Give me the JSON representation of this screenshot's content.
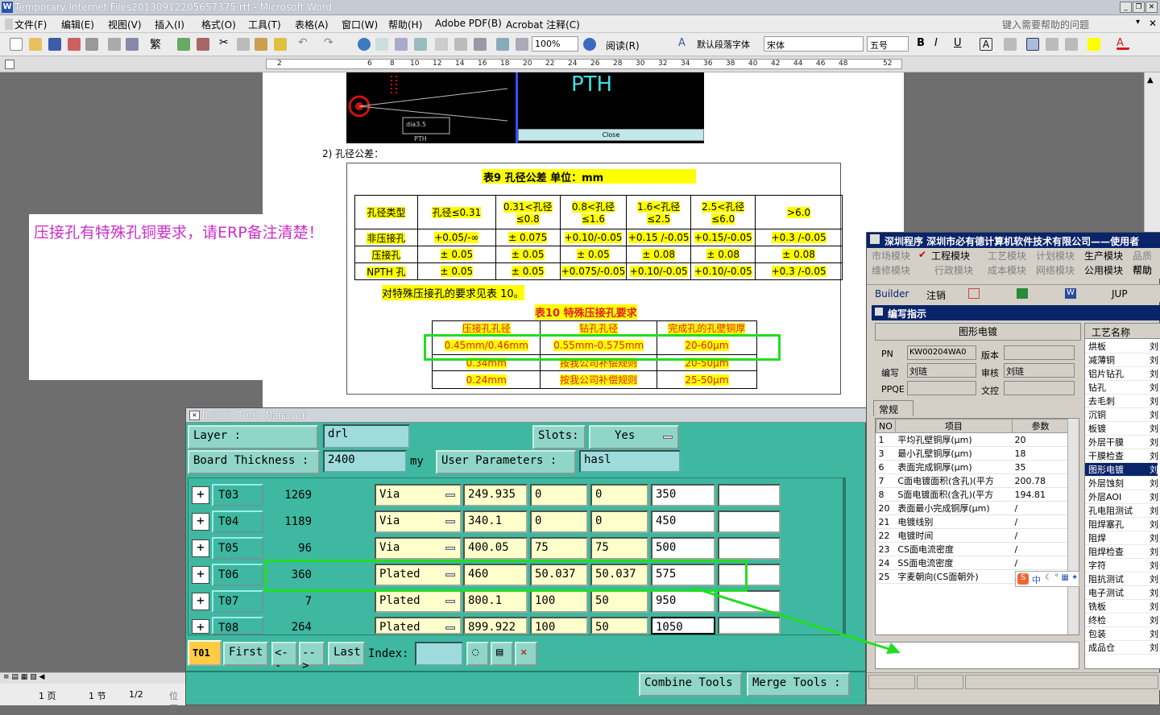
{
  "word": {
    "title": "Temporary Internet Files20130912205657375.rtf - Microsoft Word",
    "menu": [
      "文件(F)",
      "编辑(E)",
      "视图(V)",
      "插入(I)",
      "格式(O)",
      "工具(T)",
      "表格(A)",
      "窗口(W)",
      "帮助(H)",
      "Adobe PDF(B)",
      "Acrobat 注释(C)"
    ],
    "help_placeholder": "键入需要帮助的问题",
    "zoom": "100%",
    "read_label": "阅读(R)",
    "style": "默认段落字体",
    "font": "宋体",
    "size": "五号",
    "ruler_numbers": [
      "2",
      "6",
      "8",
      "10",
      "12",
      "14",
      "16",
      "18",
      "20",
      "22",
      "24",
      "26",
      "28",
      "30",
      "32",
      "34",
      "36",
      "38",
      "40",
      "42",
      "44",
      "46",
      "48",
      "52"
    ],
    "status": {
      "page": "1 页",
      "section": "1 节",
      "ratio": "1/2",
      "pos": "位置"
    }
  },
  "doc": {
    "pth_text": "PTH",
    "close_text": "Close",
    "dim_text": "dia3.5",
    "pth_small": "PTH",
    "section_heading": "2)  孔径公差：",
    "table9_title": "表9    孔径公差            单位：mm",
    "table9_headers": [
      "孔径类型",
      "孔径≤0.31",
      "0.31<孔径≤0.8",
      "0.8<孔径≤1.6",
      "1.6<孔径≤2.5",
      "2.5<孔径≤6.0",
      ">6.0"
    ],
    "table9_rows": [
      [
        "非压接孔",
        "+0.05/-∞",
        "± 0.075",
        "+0.10/-0.05",
        "+0.15 /-0.05",
        "+0.15/-0.05",
        "+0.3 /-0.05"
      ],
      [
        "压接孔",
        "± 0.05",
        "± 0.05",
        "± 0.05",
        "± 0.08",
        "± 0.08",
        "± 0.08"
      ],
      [
        "NPTH 孔",
        "± 0.05",
        "± 0.05",
        "+0.075/-0.05",
        "+0.10/-0.05",
        "+0.10/-0.05",
        "+0.3 /-0.05"
      ]
    ],
    "note_line": "对特殊压接孔的要求见表 10。",
    "table10_title": "表10   特殊压接孔要求",
    "table10_headers": [
      "压接孔孔径",
      "钻孔孔径",
      "完成孔的孔壁铜厚"
    ],
    "table10_rows": [
      [
        "0.45mm/0.46mm",
        "0.55mm-0.575mm",
        "20-60μm"
      ],
      [
        "0.34mm",
        "按我公司补偿规则",
        "20-50μm"
      ],
      [
        "0.24mm",
        "按我公司补偿规则",
        "25-50μm"
      ]
    ]
  },
  "note_text": "压接孔有特殊孔铜要求，请ERP备注清楚！",
  "dtm": {
    "title": "Drill Tool Manager",
    "layer_label": "Layer            :",
    "layer_value": "drl",
    "slots_label": "Slots:",
    "slots_value": "Yes",
    "thickness_label": "Board Thickness :",
    "thickness_value": "2400",
    "thickness_unit": "my",
    "user_params_label": "User Parameters :",
    "user_params_value": "hasl",
    "rows": [
      {
        "name": "T03",
        "count": "1269",
        "type": "Via",
        "finish": "249.935",
        "p": "0",
        "m": "0",
        "drill": "350"
      },
      {
        "name": "T04",
        "count": "1189",
        "type": "Via",
        "finish": "340.1",
        "p": "0",
        "m": "0",
        "drill": "450"
      },
      {
        "name": "T05",
        "count": "96",
        "type": "Via",
        "finish": "400.05",
        "p": "75",
        "m": "75",
        "drill": "500"
      },
      {
        "name": "T06",
        "count": "360",
        "type": "Plated",
        "finish": "460",
        "p": "50.037",
        "m": "50.037",
        "drill": "575"
      },
      {
        "name": "T07",
        "count": "7",
        "type": "Plated",
        "finish": "800.1",
        "p": "100",
        "m": "50",
        "drill": "950"
      },
      {
        "name": "T08",
        "count": "264",
        "type": "Plated",
        "finish": "899.922",
        "p": "100",
        "m": "50",
        "drill": "1050"
      }
    ],
    "current_tool": "T01",
    "first": "First",
    "prev": "<--",
    "next": "-->",
    "last": "Last",
    "index_label": "Index:",
    "combine": "Combine Tools",
    "merge": "Merge Tools :"
  },
  "rp": {
    "title": "深圳程序    深圳市必有德计算机软件技术有限公司——使用者",
    "menu1": [
      "市场模块",
      "工程模块",
      "工艺模块",
      "计划模块",
      "生产模块",
      "品质模块"
    ],
    "menu2": [
      "维修模块",
      "行政模块",
      "成本模块",
      "网络模块",
      "公用模块",
      "帮助"
    ],
    "builder": "Builder",
    "logout": "注销",
    "jup": "JUP",
    "panel_title": "编写指示",
    "process": "图形电镀",
    "pn_label": "PN",
    "pn_value": "KW00204WA0",
    "version_label": "版本",
    "editor_label": "编写",
    "editor_value": "刘琏",
    "review_label": "审核",
    "review_value": "刘琏",
    "ppqe_label": "PPQE",
    "doc_label": "文控",
    "tab": "常规",
    "grid_headers": [
      "NO",
      "项目",
      "参数"
    ],
    "grid_rows": [
      [
        "1",
        "平均孔壁铜厚(μm)",
        "20"
      ],
      [
        "3",
        "最小孔壁铜厚(μm)",
        "18"
      ],
      [
        "6",
        "表面完成铜厚(μm)",
        "35"
      ],
      [
        "7",
        "C面电镀面积(含孔)(平方",
        "200.78"
      ],
      [
        "8",
        "S面电镀面积(含孔)(平方",
        "194.81"
      ],
      [
        "20",
        "表面最小完成铜厚(μm)",
        "/"
      ],
      [
        "21",
        "电镀线别",
        "/"
      ],
      [
        "22",
        "电镀时间",
        "/"
      ],
      [
        "23",
        "CS面电流密度",
        "/"
      ],
      [
        "24",
        "SS面电流密度",
        "/"
      ],
      [
        "25",
        "字麦朝向(CS面朝外)",
        "/"
      ]
    ],
    "process_header": "工艺名称",
    "processes": [
      "烘板",
      "减薄铜",
      "铝片钻孔",
      "钻孔",
      "去毛刺",
      "沉铜",
      "板镀",
      "外层干膜",
      "干膜检查",
      "图形电镀",
      "外层蚀刻",
      "外层AOI",
      "孔电阻测试",
      "阻焊塞孔",
      "阻焊",
      "阻焊检查",
      "字符",
      "阻抗测试",
      "电子测试",
      "铣板",
      "终检",
      "包装",
      "成品仓"
    ],
    "process_col2": "刘",
    "ime_text": "中",
    "ime_label": "S"
  }
}
